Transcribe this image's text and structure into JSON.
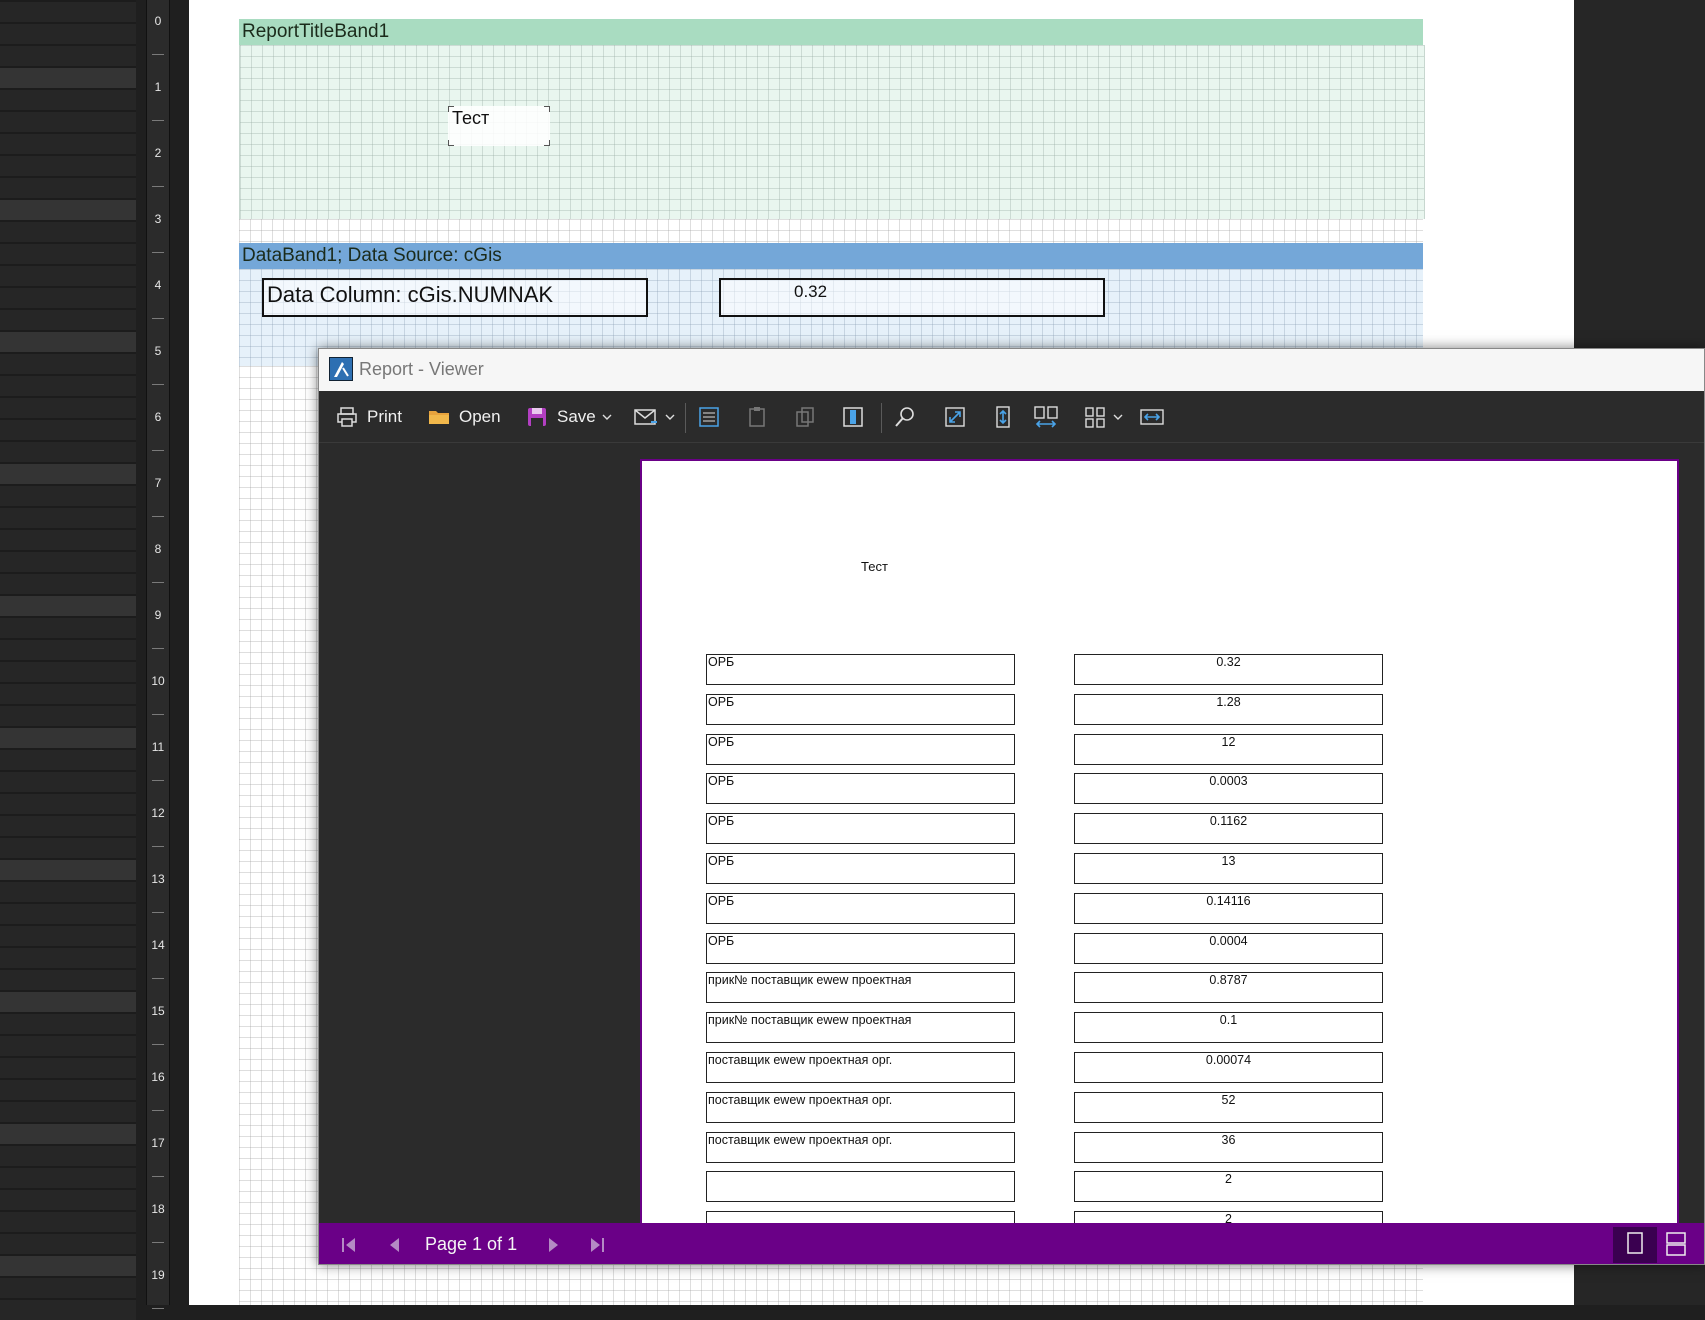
{
  "ruler": {
    "numbers": [
      "0",
      "1",
      "2",
      "3",
      "4",
      "5",
      "6",
      "7",
      "8",
      "9",
      "10",
      "11",
      "12",
      "13",
      "14",
      "15",
      "16",
      "17",
      "18",
      "19"
    ]
  },
  "designer": {
    "report_title_band": "ReportTitleBand1",
    "title_text": "Тест",
    "data_band": "DataBand1; Data Source: cGis",
    "data_column_text": "Data Column: cGis.NUMNAK",
    "value_text": "0.32"
  },
  "viewer": {
    "title": "Report - Viewer",
    "toolbar": {
      "print": "Print",
      "open": "Open",
      "save": "Save"
    },
    "report": {
      "title": "Тест",
      "rows": [
        {
          "name": "ОРБ",
          "value": "0.32"
        },
        {
          "name": "ОРБ",
          "value": "1.28"
        },
        {
          "name": "ОРБ",
          "value": "12"
        },
        {
          "name": "ОРБ",
          "value": "0.0003"
        },
        {
          "name": "ОРБ",
          "value": "0.1162"
        },
        {
          "name": "ОРБ",
          "value": "13"
        },
        {
          "name": "ОРБ",
          "value": "0.14116"
        },
        {
          "name": "ОРБ",
          "value": "0.0004"
        },
        {
          "name": "прик№ поставщик ewew проектная",
          "value": "0.8787"
        },
        {
          "name": "прик№ поставщик ewew проектная",
          "value": "0.1"
        },
        {
          "name": "поставщик ewew проектная орг.",
          "value": "0.00074"
        },
        {
          "name": "поставщик ewew проектная орг.",
          "value": "52"
        },
        {
          "name": "поставщик ewew проектная орг.",
          "value": "36"
        },
        {
          "name": "",
          "value": "2"
        },
        {
          "name": "",
          "value": "2"
        }
      ]
    },
    "status": {
      "page_label": "Page 1 of 1"
    },
    "colors": {
      "accent": "#6a0087",
      "band_green": "#a9dcc1",
      "band_blue": "#74a7d8"
    }
  }
}
